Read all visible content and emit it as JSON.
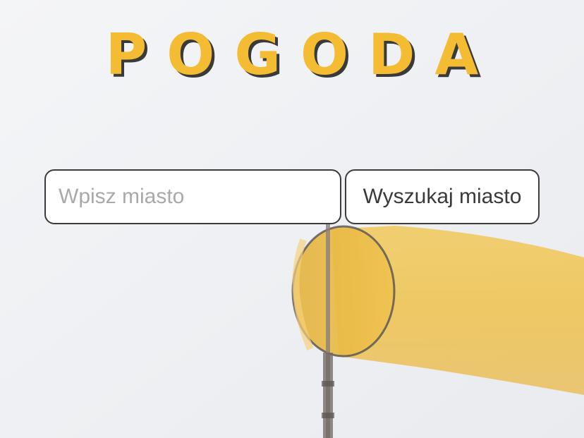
{
  "header": {
    "title": "POGODA"
  },
  "search": {
    "placeholder": "Wpisz miasto",
    "value": "",
    "button_label": "Wyszukaj miasto"
  },
  "background": {
    "image": "windsock-photo",
    "sky_color": "#eef0f3",
    "windsock_color": "#f0c040"
  },
  "colors": {
    "title": "#f3bc32",
    "title_shadow": "#3a3a3a",
    "border": "#3c3c3c"
  }
}
